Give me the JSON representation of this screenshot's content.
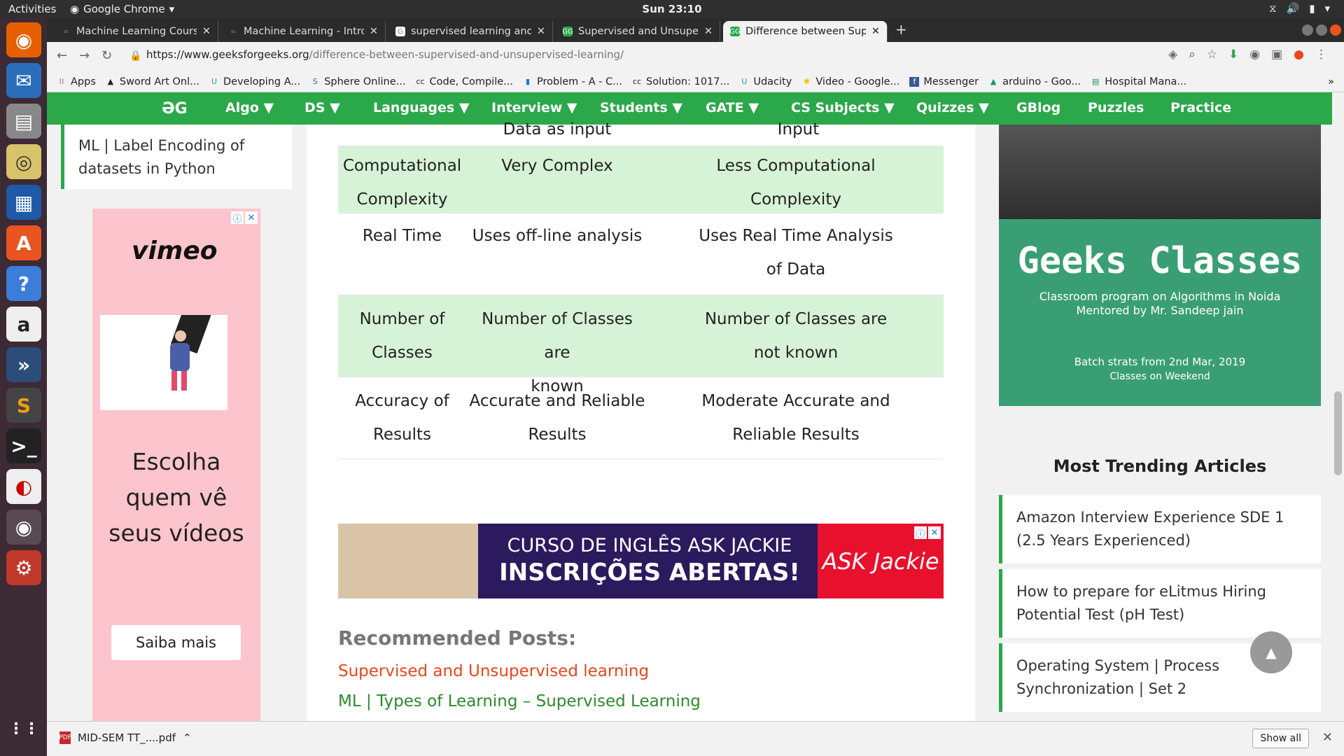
{
  "topbar": {
    "activities": "Activities",
    "app": "Google Chrome",
    "clock": "Sun 23:10"
  },
  "tabs": [
    {
      "title": "Machine Learning Course",
      "fav": "∞"
    },
    {
      "title": "Machine Learning - Introd",
      "fav": "∞"
    },
    {
      "title": "supervised learning and u",
      "fav": "G"
    },
    {
      "title": "Supervised and Unsuperv",
      "fav": "GG"
    },
    {
      "title": "Difference between Supe",
      "fav": "GG"
    }
  ],
  "omnibox": {
    "url_host": "https://www.geeksforgeeks.org",
    "url_path": "/difference-between-supervised-and-unsupervised-learning/"
  },
  "bookmarks": [
    {
      "label": "Apps"
    },
    {
      "label": "Sword Art Onl..."
    },
    {
      "label": "Developing A..."
    },
    {
      "label": "Sphere Online..."
    },
    {
      "label": "Code, Compile..."
    },
    {
      "label": "Problem - A - C..."
    },
    {
      "label": "Solution: 1017..."
    },
    {
      "label": "Udacity"
    },
    {
      "label": "Video - Google..."
    },
    {
      "label": "Messenger"
    },
    {
      "label": "arduino - Goo..."
    },
    {
      "label": "Hospital Mana..."
    }
  ],
  "nav": {
    "logo": "ƏG",
    "items": [
      "Algo ▼",
      "DS ▼",
      "Languages ▼",
      "Interview ▼",
      "Students ▼",
      "GATE ▼",
      "CS Subjects ▼",
      "Quizzes ▼",
      "GBlog",
      "Puzzles",
      "Practice"
    ]
  },
  "left_card": {
    "text": "ML | Label Encoding of datasets in Python"
  },
  "ad_left": {
    "brand": "vimeo",
    "tagline_1": "Escolha",
    "tagline_2": "quem vê",
    "tagline_3": "seus vídeos",
    "cta": "Saiba mais"
  },
  "table": {
    "top_partial": [
      "Data as input",
      "Input"
    ],
    "rows": [
      {
        "c1": [
          "Computational",
          "Complexity"
        ],
        "c2": [
          "Very Complex"
        ],
        "c3": [
          "Less Computational",
          "Complexity"
        ]
      },
      {
        "c1": [
          "Real Time"
        ],
        "c2": [
          "Uses off-line analysis"
        ],
        "c3": [
          "Uses Real Time Analysis",
          "of Data"
        ]
      },
      {
        "c1": [
          "Number of",
          "Classes"
        ],
        "c2": [
          "Number of Classes are",
          "known"
        ],
        "c3": [
          "Number of Classes are",
          "not known"
        ]
      },
      {
        "c1": [
          "Accuracy of",
          "Results"
        ],
        "c2": [
          "Accurate and Reliable",
          "Results"
        ],
        "c3": [
          "Moderate Accurate and",
          "Reliable Results"
        ]
      }
    ]
  },
  "ad_banner": {
    "line1": "CURSO DE INGLÊS ASK JACKIE",
    "line2": "INSCRIÇÕES ABERTAS!",
    "logo": "ASK Jackie"
  },
  "recommended": {
    "heading": "Recommended Posts:",
    "links": [
      "Supervised and Unsupervised learning",
      "ML | Types of Learning – Supervised Learning"
    ]
  },
  "geeks_classes": {
    "title": "Geeks Classes",
    "line1": "Classroom program on Algorithms in Noida",
    "line2": "Mentored by Mr. Sandeep jain",
    "batch": "Batch strats from 2nd Mar, 2019",
    "weekend": "Classes on Weekend"
  },
  "trending": {
    "heading": "Most Trending Articles",
    "items": [
      "Amazon Interview Experience SDE 1 (2.5 Years Experienced)",
      "How to prepare for eLitmus Hiring Potential Test (pH Test)",
      "Operating System | Process Synchronization | Set 2"
    ]
  },
  "download": {
    "file": "MID-SEM TT_....pdf",
    "show_all": "Show all"
  }
}
